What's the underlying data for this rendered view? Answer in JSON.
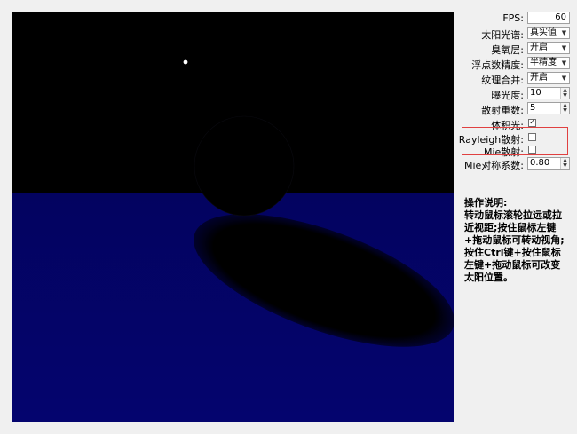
{
  "settings": {
    "fps": {
      "label": "FPS:",
      "value": "60"
    },
    "spectrum": {
      "label": "太阳光谱:",
      "value": "真实值"
    },
    "ozone": {
      "label": "臭氧层:",
      "value": "开启"
    },
    "precision": {
      "label": "浮点数精度:",
      "value": "半精度"
    },
    "texture_merge": {
      "label": "纹理合并:",
      "value": "开启"
    },
    "exposure": {
      "label": "曝光度:",
      "value": "10"
    },
    "scatter_order": {
      "label": "散射重数:",
      "value": "5"
    },
    "volumetric_light": {
      "label": "体积光:",
      "checked": true
    },
    "rayleigh": {
      "label": "Rayleigh散射:",
      "checked": false
    },
    "mie": {
      "label": "Mie散射:",
      "checked": false
    },
    "mie_asym": {
      "label": "Mie对称系数:",
      "value": "0.80"
    }
  },
  "instructions": {
    "title": "操作说明:",
    "text": "转动鼠标滚轮拉远或拉近视距;按住鼠标左键+拖动鼠标可转动视角;按住Ctrl键+按住鼠标左键+拖动鼠标可改变太阳位置。"
  },
  "colors": {
    "ground": "#030368",
    "sky": "#000000",
    "highlight_border": "#e04040"
  },
  "icons": {
    "dropdown": "chevron-down-icon",
    "spinner": "spinner-arrows-icon",
    "check": "checkmark-icon"
  }
}
